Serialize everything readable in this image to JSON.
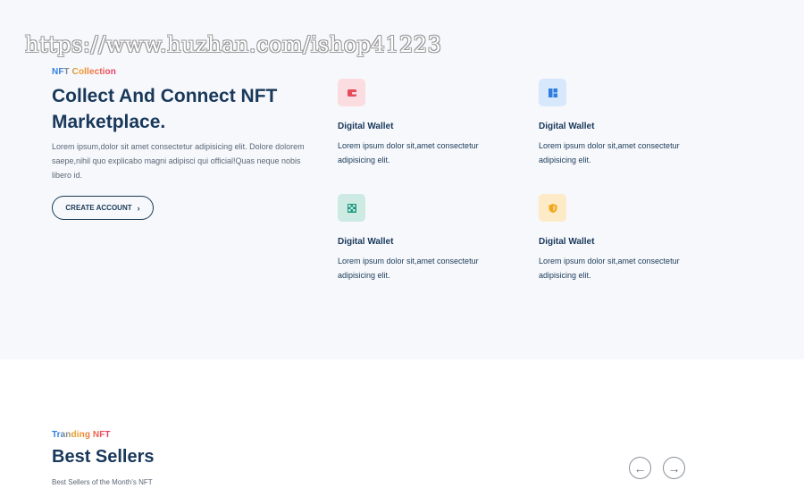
{
  "watermark": "https://www.huzhan.com/ishop41223",
  "hero": {
    "eyebrow": "NFT Collection",
    "title": "Collect And Connect NFT Marketplace.",
    "description": "Lorem ipsum,dolor sit amet consectetur adipisicing elit. Dolore dolorem saepe,nihil quo explicabo magni adipisci qui official!Quas neque nobis libero id.",
    "cta_label": "CREATE ACCOUNT",
    "cta_icon": "chevron-right-icon"
  },
  "features": [
    {
      "icon": "wallet-icon",
      "icon_bg": "#fbdde1",
      "icon_color": "#e54b5b",
      "title": "Digital Wallet",
      "description": "Lorem ipsum dolor sit,amet consectetur adipisicing elit."
    },
    {
      "icon": "grid-icon",
      "icon_bg": "#d7e8fc",
      "icon_color": "#2f7de1",
      "title": "Digital Wallet",
      "description": "Lorem ipsum dolor sit,amet consectetur adipisicing elit."
    },
    {
      "icon": "checker-icon",
      "icon_bg": "#cdeae3",
      "icon_color": "#1f9a7e",
      "title": "Digital Wallet",
      "description": "Lorem ipsum dolor sit,amet consectetur adipisicing elit."
    },
    {
      "icon": "shield-icon",
      "icon_bg": "#fdebc7",
      "icon_color": "#f2a51a",
      "title": "Digital Wallet",
      "description": "Lorem ipsum dolor sit,amet consectetur adipisicing elit."
    }
  ],
  "best_sellers": {
    "eyebrow": "Tranding NFT",
    "title": "Best Sellers",
    "subtitle": "Best Sellers of the Month's NFT",
    "prev_icon": "arrow-left-icon",
    "next_icon": "arrow-right-icon"
  }
}
